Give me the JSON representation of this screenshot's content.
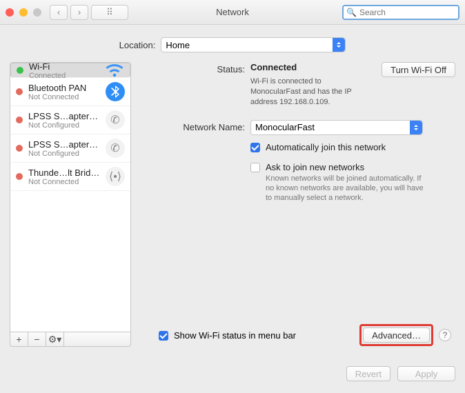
{
  "window": {
    "title": "Network"
  },
  "search": {
    "placeholder": "Search"
  },
  "location": {
    "label": "Location:",
    "value": "Home"
  },
  "sidebar": {
    "items": [
      {
        "name": "Wi-Fi",
        "status": "Connected",
        "dot": "green",
        "icon": "wifi",
        "selected": true
      },
      {
        "name": "Bluetooth PAN",
        "status": "Not Connected",
        "dot": "red",
        "icon": "bluetooth"
      },
      {
        "name": "LPSS S…apter (1)",
        "status": "Not Configured",
        "dot": "red",
        "icon": "phone"
      },
      {
        "name": "LPSS S…apter (2)",
        "status": "Not Configured",
        "dot": "red",
        "icon": "phone"
      },
      {
        "name": "Thunde…lt Bridge",
        "status": "Not Connected",
        "dot": "red",
        "icon": "bridge"
      }
    ]
  },
  "main": {
    "status_label": "Status:",
    "status_value": "Connected",
    "turn_off": "Turn Wi-Fi Off",
    "status_sub": "Wi-Fi is connected to MonocularFast and has the IP address 192.168.0.109.",
    "netname_label": "Network Name:",
    "netname_value": "MonocularFast",
    "auto_join": "Automatically join this network",
    "ask_join": "Ask to join new networks",
    "ask_join_sub": "Known networks will be joined automatically. If no known networks are available, you will have to manually select a network.",
    "show_menu": "Show Wi-Fi status in menu bar",
    "advanced": "Advanced…"
  },
  "buttons": {
    "revert": "Revert",
    "apply": "Apply"
  },
  "glyphs": {
    "back": "‹",
    "fwd": "›",
    "grid": "⠿",
    "search": "🔍",
    "plus": "+",
    "minus": "−",
    "gear": "⚙︎▾",
    "help": "?"
  }
}
